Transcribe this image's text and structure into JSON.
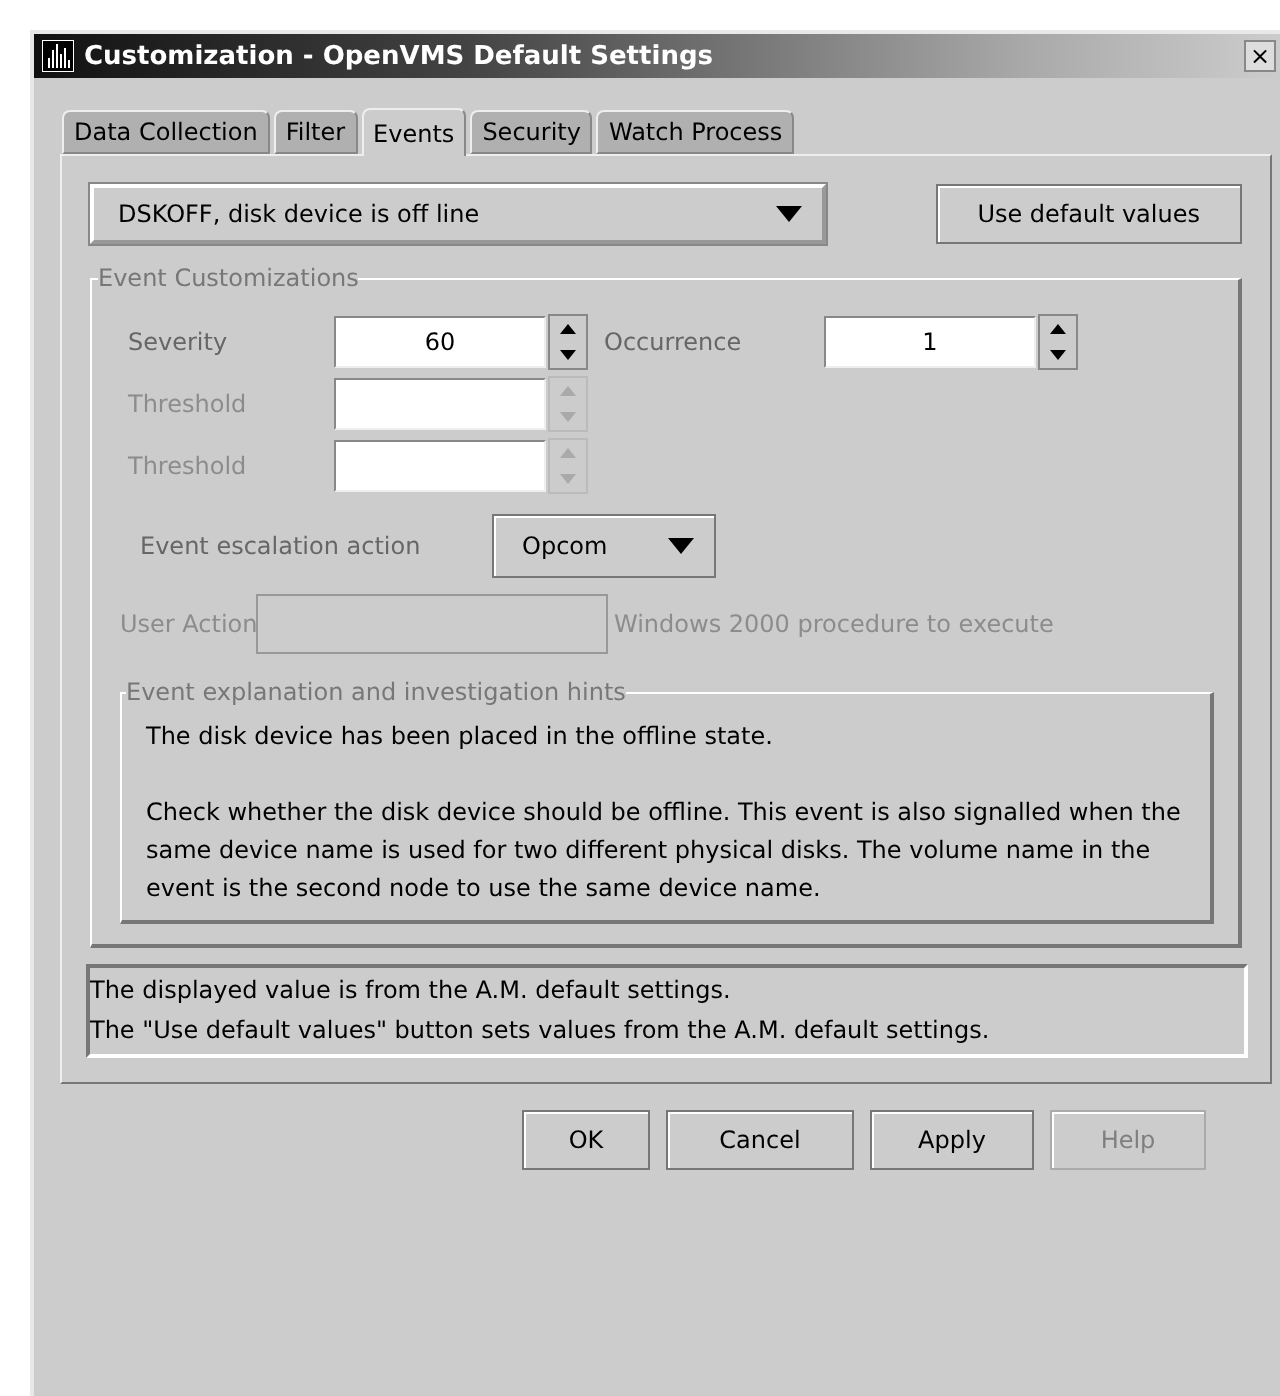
{
  "window": {
    "title": "Customization - OpenVMS Default Settings",
    "close": "×"
  },
  "tabs": [
    {
      "label": "Data Collection",
      "selected": false
    },
    {
      "label": "Filter",
      "selected": false
    },
    {
      "label": "Events",
      "selected": true
    },
    {
      "label": "Security",
      "selected": false
    },
    {
      "label": "Watch Process",
      "selected": false
    }
  ],
  "event_select": {
    "value": "DSKOFF, disk device is off line"
  },
  "default_button": {
    "label": "Use default values"
  },
  "customizations": {
    "title": "Event Customizations",
    "spinners": [
      {
        "label": "Severity",
        "value": "60",
        "disabled": false,
        "occurrence": {
          "label": "Occurrence",
          "value": "1"
        }
      },
      {
        "label": "Threshold",
        "disabled": true
      },
      {
        "label": "Threshold",
        "disabled": true
      }
    ],
    "escalation": {
      "label": "Event escalation action",
      "value": "Opcom"
    },
    "user_action": {
      "label": "User Action",
      "hint": "Windows 2000 procedure to execute",
      "disabled": true
    },
    "hints": {
      "title": "Event explanation and investigation hints",
      "paragraphs": [
        "The disk device has been placed in the offline state.",
        "Check whether the disk device should be offline. This event is also signalled when the same device name is used for two different physical disks. The volume name in the event is the second node to use the same device name."
      ]
    }
  },
  "status_lines": [
    "The displayed value is from the A.M. default settings.",
    "The \"Use default values\" button sets values from the A.M. default settings."
  ],
  "buttons": [
    {
      "label": "OK",
      "disabled": false
    },
    {
      "label": "Cancel",
      "disabled": false
    },
    {
      "label": "Apply",
      "disabled": false
    },
    {
      "label": "Help",
      "disabled": true
    }
  ]
}
